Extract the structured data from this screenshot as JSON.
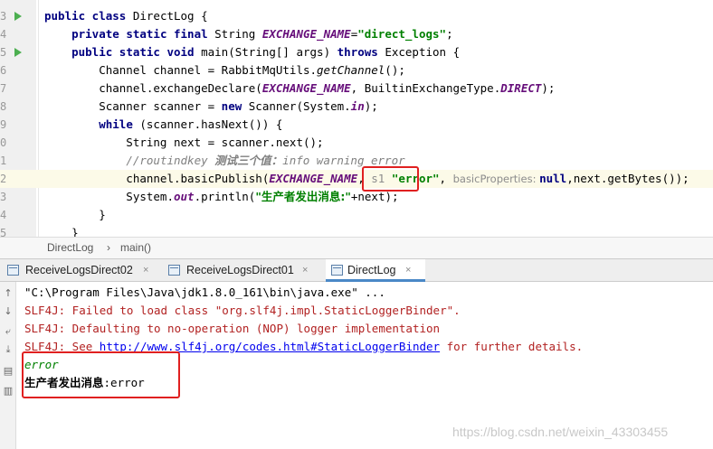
{
  "editor": {
    "lines": [
      {
        "num": "3",
        "run": true,
        "parts": [
          [
            "kw",
            "public class "
          ],
          [
            "t",
            "DirectLog {"
          ]
        ]
      },
      {
        "num": "4",
        "run": false,
        "parts": [
          [
            "t",
            "    "
          ],
          [
            "kw",
            "private static final "
          ],
          [
            "t",
            "String "
          ],
          [
            "fld",
            "EXCHANGE_NAME"
          ],
          [
            "t",
            "="
          ],
          [
            "str",
            "\"direct_logs\""
          ],
          [
            "t",
            ";"
          ]
        ]
      },
      {
        "num": "5",
        "run": true,
        "parts": [
          [
            "t",
            "    "
          ],
          [
            "kw",
            "public static void "
          ],
          [
            "t",
            "main(String[] args) "
          ],
          [
            "kw",
            "throws "
          ],
          [
            "t",
            "Exception {"
          ]
        ]
      },
      {
        "num": "6",
        "run": false,
        "parts": [
          [
            "t",
            "        Channel channel = RabbitMqUtils."
          ],
          [
            "stat",
            "getChannel"
          ],
          [
            "t",
            "();"
          ]
        ]
      },
      {
        "num": "7",
        "run": false,
        "parts": [
          [
            "t",
            "        channel.exchangeDeclare("
          ],
          [
            "fld",
            "EXCHANGE_NAME"
          ],
          [
            "t",
            ", BuiltinExchangeType."
          ],
          [
            "fld",
            "DIRECT"
          ],
          [
            "t",
            ");"
          ]
        ]
      },
      {
        "num": "8",
        "run": false,
        "parts": [
          [
            "t",
            "        Scanner scanner = "
          ],
          [
            "kw",
            "new "
          ],
          [
            "t",
            "Scanner(System."
          ],
          [
            "fld",
            "in"
          ],
          [
            "t",
            ");"
          ]
        ]
      },
      {
        "num": "9",
        "run": false,
        "parts": [
          [
            "t",
            "        "
          ],
          [
            "kw",
            "while "
          ],
          [
            "t",
            "(scanner.hasNext()) {"
          ]
        ]
      },
      {
        "num": "0",
        "run": false,
        "parts": [
          [
            "t",
            "            String next = scanner.next();"
          ]
        ]
      },
      {
        "num": "1",
        "run": false,
        "parts": [
          [
            "t",
            "            "
          ],
          [
            "cmt",
            "//routindkey "
          ],
          [
            "cmt-cn",
            "测试三个值："
          ],
          [
            "cmt",
            "info warning error"
          ]
        ]
      },
      {
        "num": "2",
        "run": false,
        "highlight": true,
        "parts": [
          [
            "t",
            "            channel.basicPublish("
          ],
          [
            "fld",
            "EXCHANGE_NAME"
          ],
          [
            "t",
            ", "
          ],
          [
            "hint-s",
            "s1 "
          ],
          [
            "str",
            "\"error\""
          ],
          [
            "t",
            ", "
          ],
          [
            "hint",
            "basicProperties: "
          ],
          [
            "kw",
            "null"
          ],
          [
            "t",
            ",next.getBytes());"
          ]
        ]
      },
      {
        "num": "3",
        "run": false,
        "parts": [
          [
            "t",
            "            System."
          ],
          [
            "fld",
            "out"
          ],
          [
            "t",
            ".println("
          ],
          [
            "str-cn",
            "\"生产者发出消息:\""
          ],
          [
            "t",
            "+next);"
          ]
        ]
      },
      {
        "num": "4",
        "run": false,
        "parts": [
          [
            "t",
            "        }"
          ]
        ]
      },
      {
        "num": "5",
        "run": false,
        "parts": [
          [
            "t",
            "    }"
          ]
        ]
      }
    ]
  },
  "breadcrumb": {
    "items": [
      "DirectLog",
      "main()"
    ],
    "separator": "›"
  },
  "tabs": [
    {
      "label": "ReceiveLogsDirect02",
      "close": "×",
      "active": false
    },
    {
      "label": "ReceiveLogsDirect01",
      "close": "×",
      "active": false
    },
    {
      "label": "DirectLog",
      "close": "×",
      "active": true
    }
  ],
  "console": {
    "cmd": "\"C:\\Program Files\\Java\\jdk1.8.0_161\\bin\\java.exe\" ...",
    "slf1": "SLF4J: Failed to load class \"org.slf4j.impl.StaticLoggerBinder\".",
    "slf2": "SLF4J: Defaulting to no-operation (NOP) logger implementation",
    "slf3_prefix": "SLF4J: See ",
    "slf3_link": "http://www.slf4j.org/codes.html#StaticLoggerBinder",
    "slf3_suffix": " for further details.",
    "input_echo": "error",
    "result_label": "生产者发出消息",
    "result_value": ":error"
  },
  "watermark": "https://blog.csdn.net/weixin_43303455",
  "colors": {
    "highlight_box": "#e02020",
    "keyword": "#000080",
    "string": "#008000",
    "field": "#660e7a"
  }
}
